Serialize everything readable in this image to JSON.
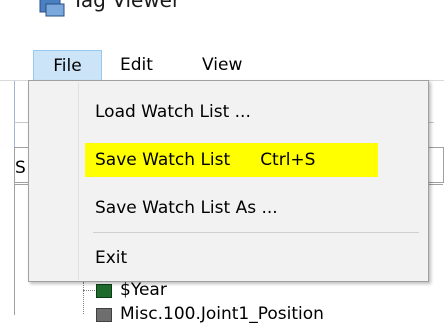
{
  "window": {
    "title": "Tag Viewer",
    "icon": "app-icon"
  },
  "menubar": {
    "file": "File",
    "edit": "Edit",
    "view": "View"
  },
  "file_menu": {
    "items": [
      {
        "label": "Load Watch List ...",
        "shortcut": ""
      },
      {
        "label": "Save Watch List",
        "shortcut": "Ctrl+S",
        "highlighted": true
      },
      {
        "label": "Save Watch List As ...",
        "shortcut": ""
      },
      {
        "label": "Exit",
        "shortcut": ""
      }
    ],
    "highlight_color": "#ffff00"
  },
  "background": {
    "left_letter": "S",
    "tree": {
      "item1": "$Year",
      "item2": "Misc.100.Joint1_Position"
    }
  }
}
